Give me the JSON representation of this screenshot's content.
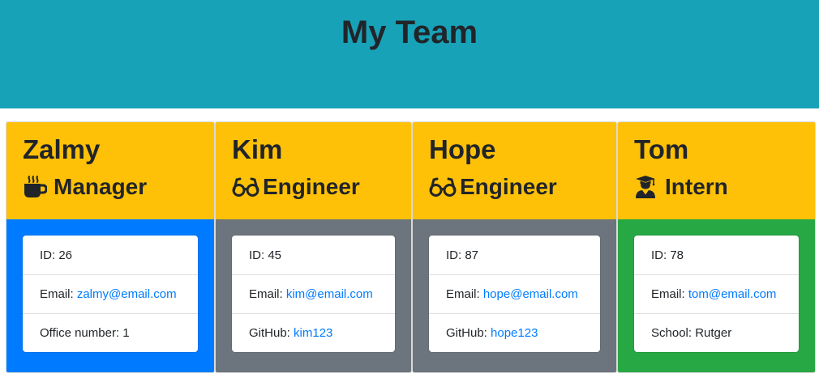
{
  "header": {
    "title": "My Team",
    "background": "#17a2b8"
  },
  "cards": [
    {
      "name": "Zalmy",
      "role": "Manager",
      "role_icon": "mug-hot-icon",
      "body_color": "#007bff",
      "id_label": "ID: 26",
      "email_label": "Email: ",
      "email": "zalmy@email.com",
      "extra_label": "Office number: 1",
      "extra_link": ""
    },
    {
      "name": "Kim",
      "role": "Engineer",
      "role_icon": "glasses-icon",
      "body_color": "#6c757d",
      "id_label": "ID: 45",
      "email_label": "Email: ",
      "email": "kim@email.com",
      "extra_label": "GitHub: ",
      "extra_link": "kim123"
    },
    {
      "name": "Hope",
      "role": "Engineer",
      "role_icon": "glasses-icon",
      "body_color": "#6c757d",
      "id_label": "ID: 87",
      "email_label": "Email: ",
      "email": "hope@email.com",
      "extra_label": "GitHub: ",
      "extra_link": "hope123"
    },
    {
      "name": "Tom",
      "role": "Intern",
      "role_icon": "graduate-icon",
      "body_color": "#28a745",
      "id_label": "ID: 78",
      "email_label": "Email: ",
      "email": "tom@email.com",
      "extra_label": "School: Rutger",
      "extra_link": ""
    }
  ],
  "card_header_color": "#ffc107"
}
